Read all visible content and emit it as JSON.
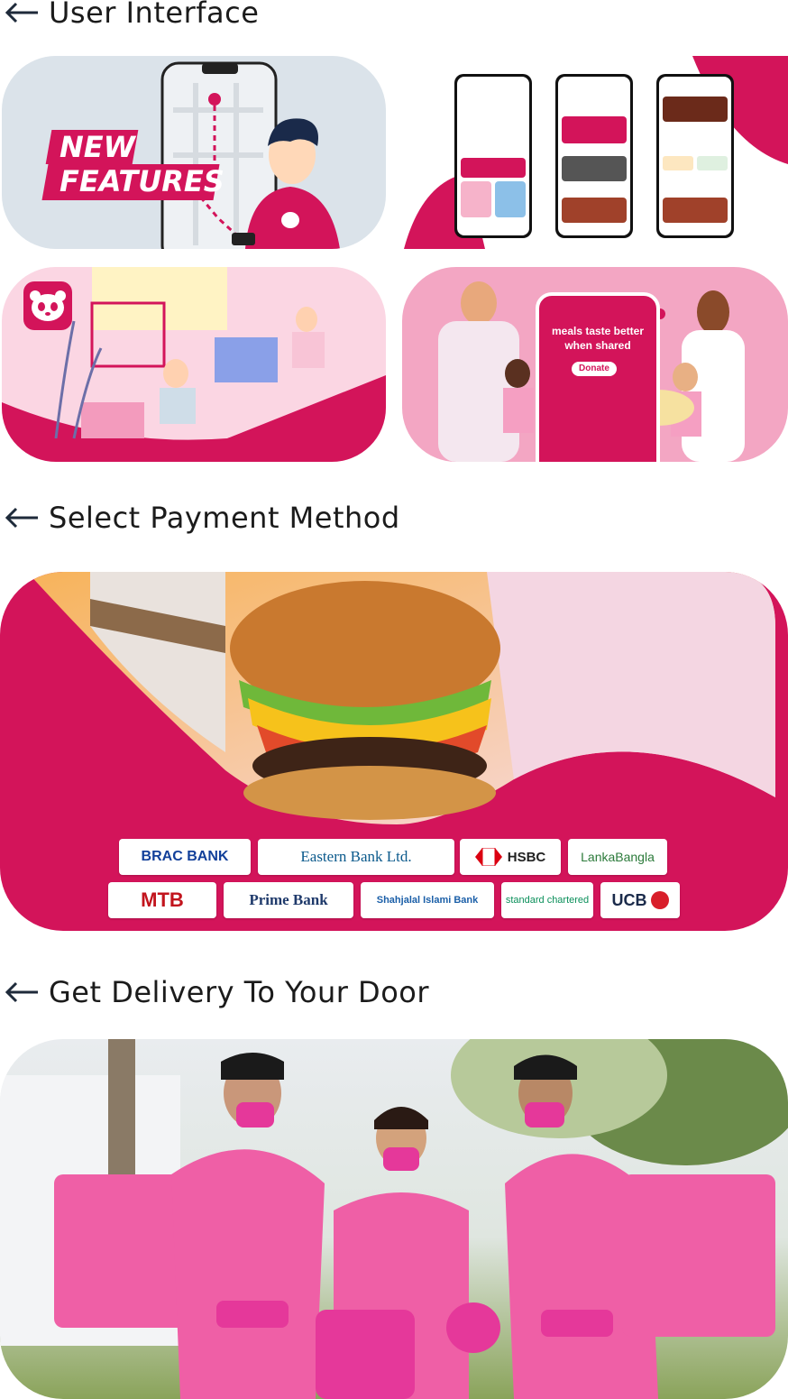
{
  "sections": {
    "ui": {
      "title": "User Interface"
    },
    "payment": {
      "title": "Select Payment Method"
    },
    "delivery": {
      "title": "Get Delivery To Your Door"
    }
  },
  "new_features": {
    "line1": "NEW",
    "line2": "FEATURES"
  },
  "donate": {
    "headline_line1": "meals taste better",
    "headline_line2": "when shared",
    "button": "Donate"
  },
  "banks": [
    "BRAC BANK",
    "Eastern Bank Ltd.",
    "HSBC",
    "LankaBangla",
    "MTB",
    "Prime Bank",
    "Shahjalal Islami Bank",
    "standard chartered",
    "UCB"
  ],
  "colors": {
    "brand_pink": "#d3145a",
    "light_pink": "#f7c6d9",
    "arrow_navy": "#1e2a3a"
  },
  "icons": [
    "left-arrow-icon",
    "panda-logo-icon",
    "map-pin-icon"
  ]
}
